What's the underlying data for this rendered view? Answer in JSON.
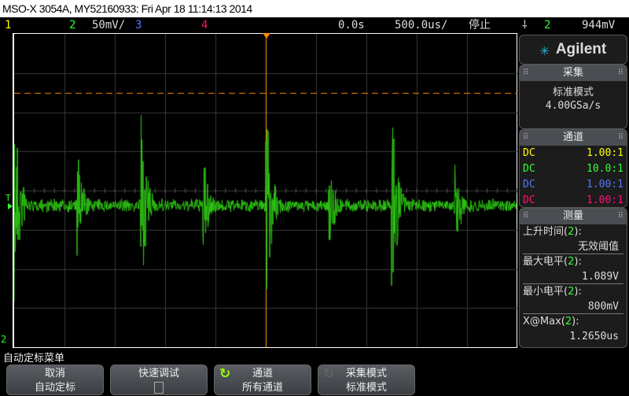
{
  "title": "MSO-X 3054A, MY52160933: Fri Apr 18 11:14:13 2014",
  "status": {
    "ch1": "1",
    "ch2": "2",
    "ch2_scale": "50mV/",
    "ch3": "3",
    "ch4": "4",
    "delay": "0.0s",
    "timebase": "500.0us/",
    "run_state": "停止",
    "trigger_icon": "rising-edge-icon",
    "trigger_source": "2",
    "trigger_level": "944mV"
  },
  "colors": {
    "ch1": "#ffff00",
    "ch2": "#33ff33",
    "ch3": "#5577ff",
    "ch4": "#ff1177",
    "trigger": "#ff8c00"
  },
  "plot": {
    "ground_marker": "2",
    "trigger_marker": "T"
  },
  "side": {
    "logo": "Agilent",
    "acquire": {
      "header": "采集",
      "mode": "标准模式",
      "rate": "4.00GSa/s"
    },
    "channels": {
      "header": "通道",
      "rows": [
        {
          "coupling": "DC",
          "probe": "1.00:1"
        },
        {
          "coupling": "DC",
          "probe": "10.0:1"
        },
        {
          "coupling": "DC",
          "probe": "1.00:1"
        },
        {
          "coupling": "DC",
          "probe": "1.00:1"
        }
      ]
    },
    "measure": {
      "header": "测量",
      "items": [
        {
          "label": "上升时间(",
          "ch": "2",
          "end": "):",
          "value": "无效阈值"
        },
        {
          "label": "最大电平(",
          "ch": "2",
          "end": "):",
          "value": "1.089V"
        },
        {
          "label": "最小电平(",
          "ch": "2",
          "end": "):",
          "value": "800mV"
        },
        {
          "label": "X@Max(",
          "ch": "2",
          "end": "):",
          "value": "1.2650us"
        }
      ]
    }
  },
  "menu": {
    "title": "自动定标菜单",
    "softkeys": [
      {
        "top": "取消",
        "bottom": "自动定标"
      },
      {
        "top": "快速调试",
        "bottom": ""
      },
      {
        "top": "通道",
        "bottom": "所有通道"
      },
      {
        "top": "采集模式",
        "bottom": "标准模式"
      }
    ]
  }
}
